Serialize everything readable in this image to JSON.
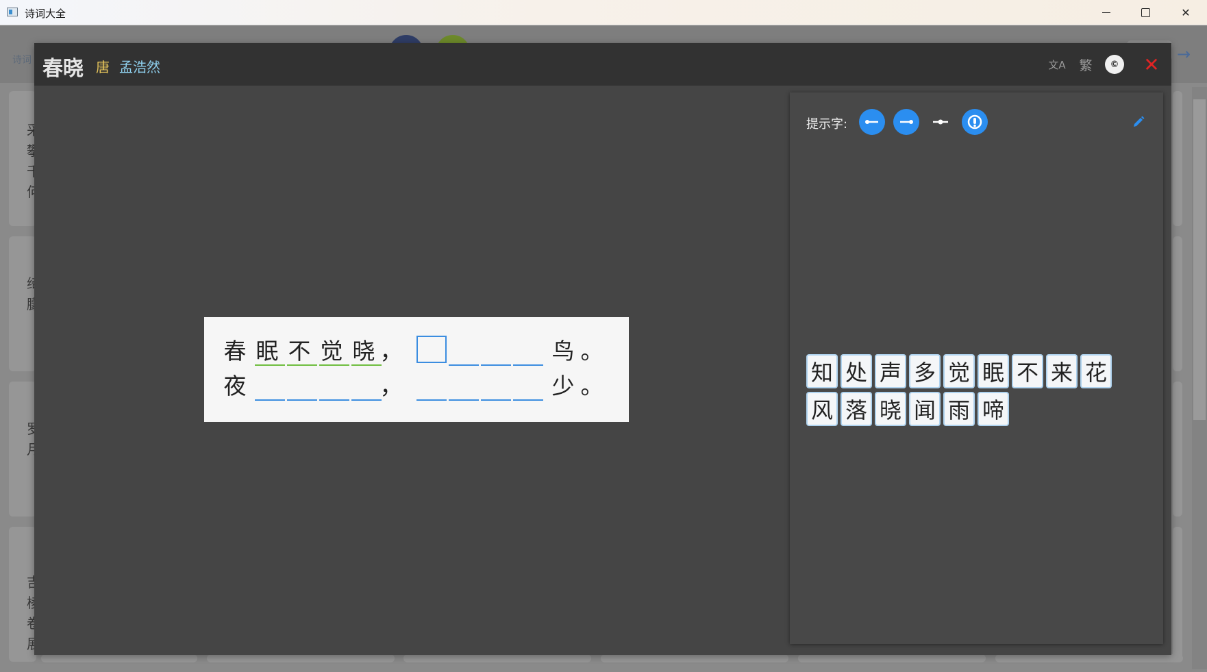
{
  "window": {
    "title": "诗词大全"
  },
  "background": {
    "nav_text": "诗词",
    "cards": [
      {
        "text": "采\n攀\n千\n何"
      },
      {
        "text": "绮\n朦"
      },
      {
        "text": "罗\n月"
      },
      {
        "text": "吉\n棱\n卷\n展"
      }
    ]
  },
  "header": {
    "title": "春晓",
    "dynasty": "唐",
    "author": "孟浩然",
    "translate_icon": "文A",
    "traditional_label": "繁",
    "copy_label": "©",
    "close_label": "✕"
  },
  "poem": {
    "line1": {
      "chars": [
        "春",
        "眠",
        "不",
        "觉",
        "晓",
        "，"
      ],
      "end": [
        "鸟",
        "。"
      ]
    },
    "line2": {
      "start": [
        "夜"
      ],
      "comma": "，",
      "end": [
        "少",
        "。"
      ]
    }
  },
  "panel": {
    "hint_label": "提示字:",
    "hint_buttons": [
      "arrow-left-icon",
      "arrow-right-icon",
      "fit-icon",
      "power-icon"
    ],
    "tiles_row1": [
      "知",
      "处",
      "声",
      "多",
      "觉",
      "眠",
      "不",
      "来",
      "花"
    ],
    "tiles_row2": [
      "风",
      "落",
      "晓",
      "闻",
      "雨",
      "啼"
    ]
  },
  "colors": {
    "accent": "#2b8ef0",
    "dynasty": "#e5c45a",
    "author": "#8fd0ee",
    "close": "#e02424",
    "underline_filled": "#6ebd3e",
    "underline_blank": "#3b8de0"
  }
}
